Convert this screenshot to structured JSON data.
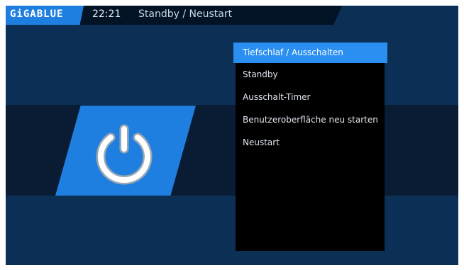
{
  "header": {
    "logo": "GiGABLUE",
    "time": "22:21",
    "title": "Standby / Neustart"
  },
  "icon": {
    "name": "power-icon"
  },
  "menu": {
    "selected_index": 0,
    "items": [
      {
        "label": "Tiefschlaf / Ausschalten"
      },
      {
        "label": "Standby"
      },
      {
        "label": "Ausschalt-Timer"
      },
      {
        "label": "Benutzeroberfläche neu starten"
      },
      {
        "label": "Neustart"
      }
    ]
  },
  "colors": {
    "background": "#0b2f55",
    "accent": "#1f7fe0",
    "selection": "#2a8ff0",
    "menu_background": "#000000"
  }
}
